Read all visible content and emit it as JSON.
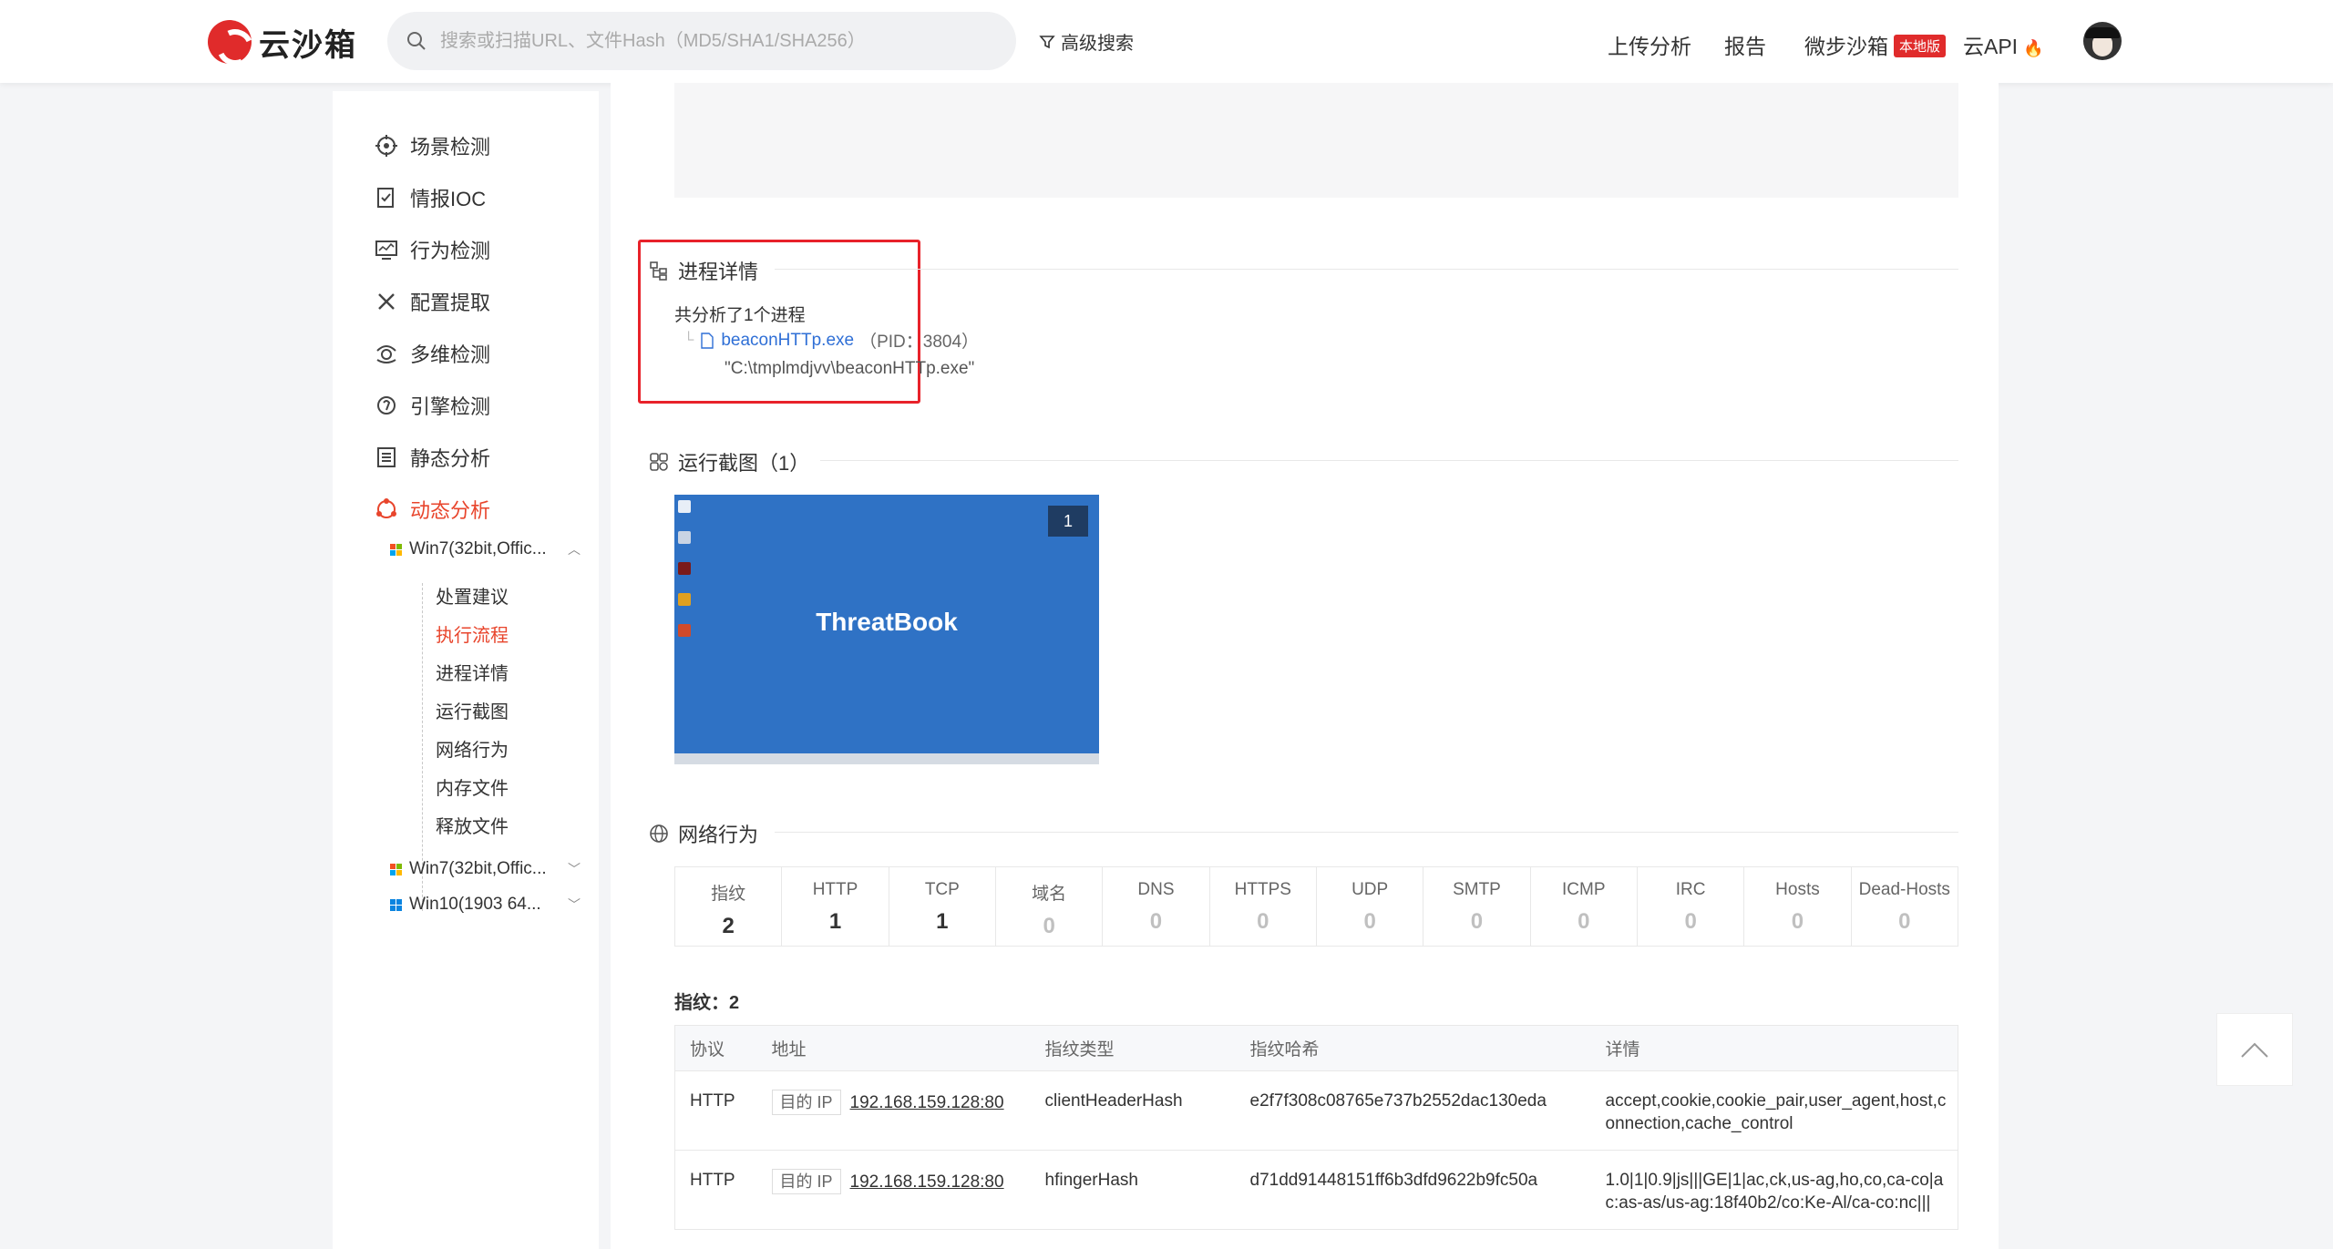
{
  "header": {
    "logo_text": "云沙箱",
    "search_placeholder": "搜索或扫描URL、文件Hash（MD5/SHA1/SHA256）",
    "advanced_search": "高级搜索",
    "nav": {
      "upload": "上传分析",
      "report": "报告",
      "micro_sandbox": "微步沙箱",
      "micro_badge": "本地版",
      "cloud_api": "云API"
    }
  },
  "sidebar": {
    "items": [
      {
        "label": "场景检测",
        "icon": "target-icon"
      },
      {
        "label": "情报IOC",
        "icon": "clipboard-check-icon"
      },
      {
        "label": "行为检测",
        "icon": "monitor-chart-icon"
      },
      {
        "label": "配置提取",
        "icon": "tools-icon"
      },
      {
        "label": "多维检测",
        "icon": "multi-scan-icon"
      },
      {
        "label": "引擎检测",
        "icon": "engine-icon"
      },
      {
        "label": "静态分析",
        "icon": "list-icon"
      },
      {
        "label": "动态分析",
        "icon": "dynamic-icon"
      }
    ],
    "env1": "Win7(32bit,Offic...",
    "tree": [
      "处置建议",
      "执行流程",
      "进程详情",
      "运行截图",
      "网络行为",
      "内存文件",
      "释放文件"
    ],
    "env2": "Win7(32bit,Offic...",
    "env3": "Win10(1903 64..."
  },
  "process": {
    "title": "进程详情",
    "summary": "共分析了1个进程",
    "name": "beaconHTTp.exe",
    "pid": "（PID：3804）",
    "cmd": "\"C:\\tmplmdjvv\\beaconHTTp.exe\""
  },
  "screenshots": {
    "title": "运行截图（1）",
    "brand": "ThreatBook",
    "index": "1"
  },
  "network": {
    "title": "网络行为",
    "stats": [
      {
        "label": "指纹",
        "value": "2"
      },
      {
        "label": "HTTP",
        "value": "1"
      },
      {
        "label": "TCP",
        "value": "1"
      },
      {
        "label": "域名",
        "value": "0"
      },
      {
        "label": "DNS",
        "value": "0"
      },
      {
        "label": "HTTPS",
        "value": "0"
      },
      {
        "label": "UDP",
        "value": "0"
      },
      {
        "label": "SMTP",
        "value": "0"
      },
      {
        "label": "ICMP",
        "value": "0"
      },
      {
        "label": "IRC",
        "value": "0"
      },
      {
        "label": "Hosts",
        "value": "0"
      },
      {
        "label": "Dead-Hosts",
        "value": "0"
      }
    ],
    "fingerprint_title": "指纹：2",
    "columns": [
      "协议",
      "地址",
      "指纹类型",
      "指纹哈希",
      "详情"
    ],
    "rows": [
      {
        "protocol": "HTTP",
        "tag": "目的 IP",
        "address": "192.168.159.128:80",
        "type": "clientHeaderHash",
        "hash": "e2f7f308c08765e737b2552dac130eda",
        "detail": "accept,cookie,cookie_pair,user_agent,host,connection,cache_control"
      },
      {
        "protocol": "HTTP",
        "tag": "目的 IP",
        "address": "192.168.159.128:80",
        "type": "hfingerHash",
        "hash": "d71dd91448151ff6b3dfd9622b9fc50a",
        "detail": "1.0|1|0.9|js|||GE|1|ac,ck,us-ag,ho,co,ca-co|ac:as-as/us-ag:18f40b2/co:Ke-Al/ca-co:nc|||"
      }
    ]
  },
  "colors": {
    "accent": "#e8452c",
    "link": "#2f6fd6",
    "highlight_box": "#e8222a"
  }
}
